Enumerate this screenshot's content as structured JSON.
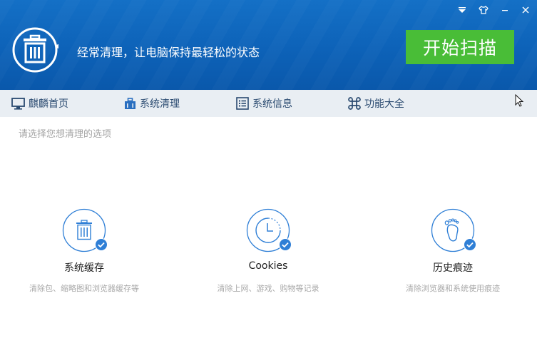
{
  "header": {
    "tagline": "经常清理，让电脑保持最轻松的状态",
    "scan_button": "开始扫描",
    "window_controls": [
      "dropdown-icon",
      "skin-icon",
      "minimize-icon",
      "close-icon"
    ]
  },
  "nav": {
    "items": [
      {
        "label": "麒麟首页",
        "icon": "monitor-icon"
      },
      {
        "label": "系统清理",
        "icon": "briefcase-icon"
      },
      {
        "label": "系统信息",
        "icon": "list-icon"
      },
      {
        "label": "功能大全",
        "icon": "command-icon"
      }
    ]
  },
  "main": {
    "prompt": "请选择您想清理的选项",
    "options": [
      {
        "title": "系统缓存",
        "desc": "清除包、缩略图和浏览器缓存等",
        "icon": "trash-icon",
        "checked": true
      },
      {
        "title": "Cookies",
        "desc": "清除上网、游戏、购物等记录",
        "icon": "clock-icon",
        "checked": true
      },
      {
        "title": "历史痕迹",
        "desc": "清除浏览器和系统使用痕迹",
        "icon": "footprint-icon",
        "checked": true
      }
    ]
  },
  "colors": {
    "header_blue": "#0d62b8",
    "scan_green": "#49bd37",
    "nav_bg": "#e9eef3",
    "accent_blue": "#2f7fd6"
  }
}
